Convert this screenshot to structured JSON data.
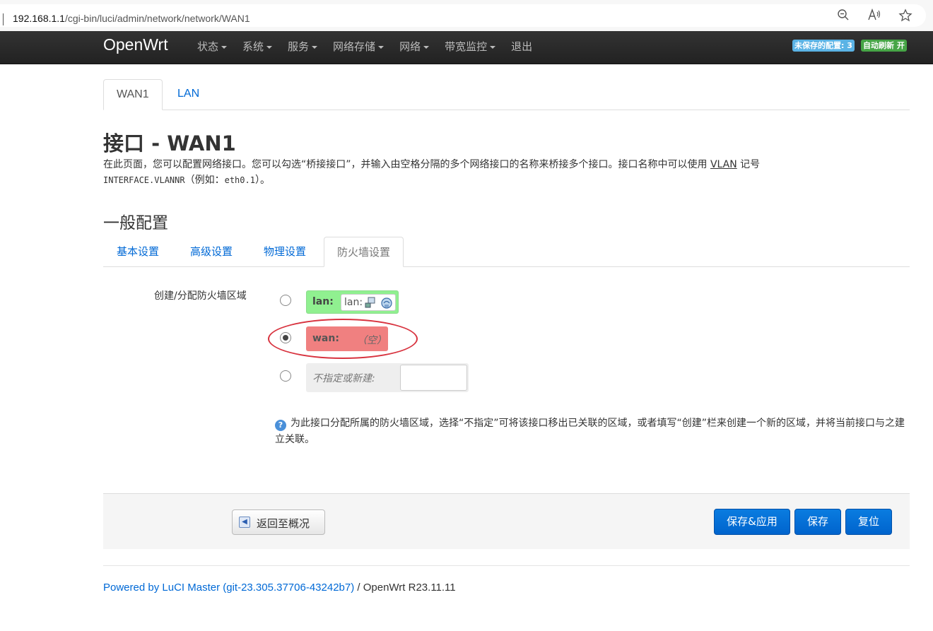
{
  "browser": {
    "url_host": "192.168.1.1",
    "url_path": "/cgi-bin/luci/admin/network/network/WAN1"
  },
  "navbar": {
    "brand": "OpenWrt",
    "items": [
      {
        "label": "状态"
      },
      {
        "label": "系统"
      },
      {
        "label": "服务"
      },
      {
        "label": "网络存储"
      },
      {
        "label": "网络"
      },
      {
        "label": "带宽监控"
      },
      {
        "label": "退出"
      }
    ],
    "unsaved_badge": "未保存的配置: 3",
    "refresh_badge": "自动刷新 开"
  },
  "top_tabs": [
    {
      "label": "WAN1",
      "active": true
    },
    {
      "label": "LAN",
      "active": false
    }
  ],
  "page": {
    "title": "接口 - WAN1",
    "desc_part1": "在此页面，您可以配置网络接口。您可以勾选“桥接接口”，并输入由空格分隔的多个网络接口的名称来桥接多个接口。接口名称中可以使用 ",
    "desc_abbr": "VLAN",
    "desc_part2": " 记号",
    "desc_mono1": "INTERFACE.VLANNR",
    "desc_part3": "（例如：",
    "desc_mono2": "eth0.1",
    "desc_part4": "）。"
  },
  "section": {
    "title": "一般配置",
    "tabs": [
      {
        "label": "基本设置",
        "active": false
      },
      {
        "label": "高级设置",
        "active": false
      },
      {
        "label": "物理设置",
        "active": false
      },
      {
        "label": "防火墙设置",
        "active": true
      }
    ]
  },
  "firewall": {
    "label": "创建/分配防火墙区域",
    "zones": [
      {
        "name": "lan:",
        "interfaces": "lan:",
        "checked": false,
        "color": "#90f090"
      },
      {
        "name": "wan:",
        "interfaces": "（空）",
        "checked": true,
        "color": "#f08080"
      }
    ],
    "new_label": "不指定或新建:",
    "new_value": "",
    "help": "为此接口分配所属的防火墙区域，选择“不指定”可将该接口移出已关联的区域，或者填写“创建”栏来创建一个新的区域，并将当前接口与之建立关联。"
  },
  "actions": {
    "back": "返回至概况",
    "save_apply": "保存&应用",
    "save": "保存",
    "reset": "复位"
  },
  "footer": {
    "link": "Powered by LuCI Master (git-23.305.37706-43242b7)",
    "text": " / OpenWrt R23.11.11"
  }
}
